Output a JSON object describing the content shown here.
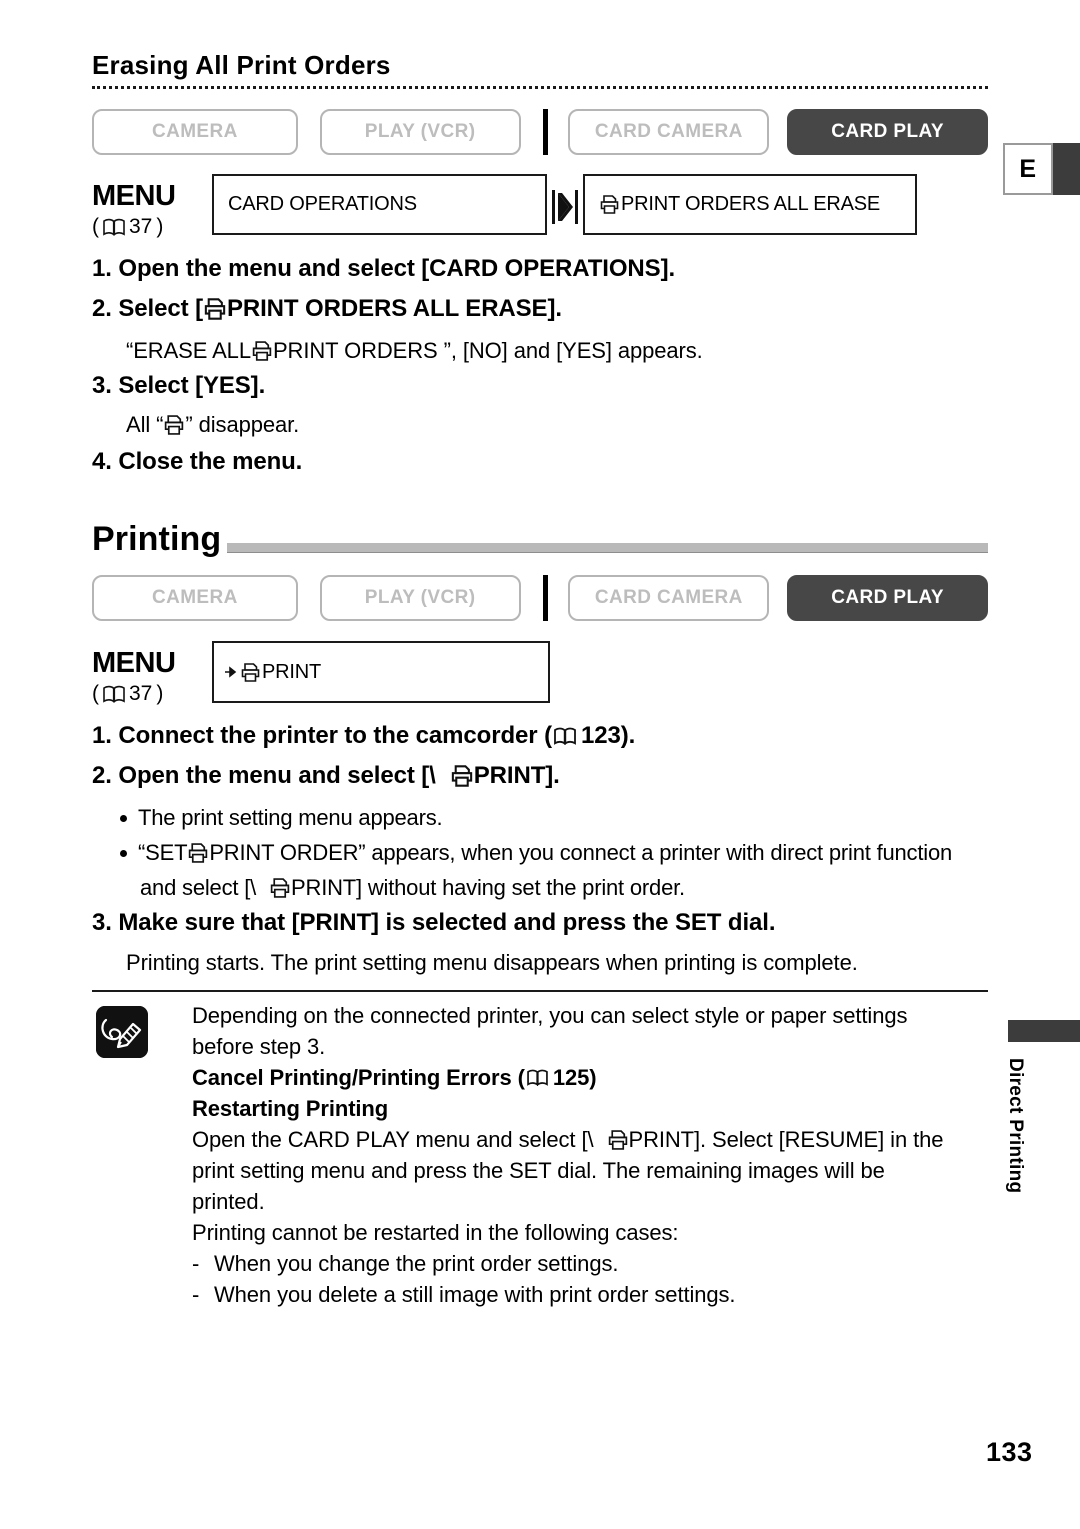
{
  "page": {
    "number": "133",
    "edge_tab_letter": "E",
    "side_label": "Direct Printing"
  },
  "section_erasing": {
    "heading": "Erasing All Print Orders",
    "mode_buttons": [
      {
        "label": "CAMERA",
        "active": false
      },
      {
        "label": "PLAY (VCR)",
        "active": false
      },
      {
        "label": "CARD CAMERA",
        "active": false
      },
      {
        "label": "CARD PLAY",
        "active": true
      }
    ],
    "menu": {
      "word": "MENU",
      "ref_open": "(",
      "ref_page": "37",
      "ref_close": ")",
      "box1": "CARD OPERATIONS",
      "arrow_icon": "double-chevron-right-icon",
      "box2_icon": "print-order-icon",
      "box2": "PRINT ORDERS ALL ERASE"
    },
    "steps": [
      {
        "text": "1. Open the menu and select [CARD OPERATIONS]."
      },
      {
        "pre": "2. Select [",
        "icon": "print-order-icon",
        "post": "PRINT ORDERS ALL ERASE]."
      },
      {
        "text": "3. Select [YES]."
      },
      {
        "text": "4. Close the menu."
      }
    ],
    "sub_texts": [
      {
        "pre": "“ERASE ALL ",
        "icon": "print-order-icon",
        "post": "PRINT ORDERS ”, [NO] and [YES] appears."
      },
      {
        "pre": "All “",
        "icon": "print-order-icon",
        "post": "” disappear."
      }
    ]
  },
  "section_printing": {
    "heading": "Printing",
    "mode_buttons": [
      {
        "label": "CAMERA",
        "active": false
      },
      {
        "label": "PLAY (VCR)",
        "active": false
      },
      {
        "label": "CARD CAMERA",
        "active": false
      },
      {
        "label": "CARD PLAY",
        "active": true
      }
    ],
    "menu": {
      "word": "MENU",
      "ref_open": "(",
      "ref_page": "37",
      "ref_close": ")",
      "arrow_icon": "arrow-right-small-icon",
      "box_icon": "print-order-icon",
      "box": "PRINT"
    },
    "step1": {
      "pre": "1. Connect the printer to the camcorder (",
      "book_icon": "book-icon",
      "page": "123",
      "post": ")."
    },
    "step2": {
      "pre": "2. Open the menu and select [\\",
      "icon": "print-order-icon",
      "post": "PRINT]."
    },
    "bullets": [
      {
        "text": "The print setting menu appears."
      },
      {
        "pre": "“SET ",
        "icon": "print-order-icon",
        "post": "PRINT ORDER” appears, when you connect a printer with direct print function"
      }
    ],
    "bullet2_cont": {
      "pre": "and select [\\",
      "icon": "print-order-icon",
      "post": "PRINT] without having set the print order."
    },
    "step3": "3. Make sure that [PRINT] is selected and press the SET dial.",
    "step3_sub": "Printing starts. The print setting menu disappears when printing is complete."
  },
  "note": {
    "icon": "note-pencil-icon",
    "lines": [
      {
        "type": "plain",
        "text": "Depending on the connected printer, you can select style or paper settings"
      },
      {
        "type": "plain",
        "text": "before step 3."
      },
      {
        "type": "strong-ref",
        "pre": "Cancel Printing/Printing Errors (",
        "book_icon": "book-icon",
        "page": "125",
        "post": ")"
      },
      {
        "type": "strong",
        "text": "Restarting Printing"
      },
      {
        "type": "icon-line",
        "pre": "Open the CARD PLAY menu and select [\\",
        "icon": "print-order-icon",
        "post": "PRINT]. Select [RESUME] in the"
      },
      {
        "type": "plain",
        "text": "print setting menu and press the SET dial. The remaining images will be"
      },
      {
        "type": "plain",
        "text": "printed."
      },
      {
        "type": "plain",
        "text": "Printing cannot be restarted in the following cases:"
      },
      {
        "type": "dash",
        "text": "When you change the print order settings."
      },
      {
        "type": "dash",
        "text": "When you delete a still image with print order settings."
      }
    ]
  }
}
